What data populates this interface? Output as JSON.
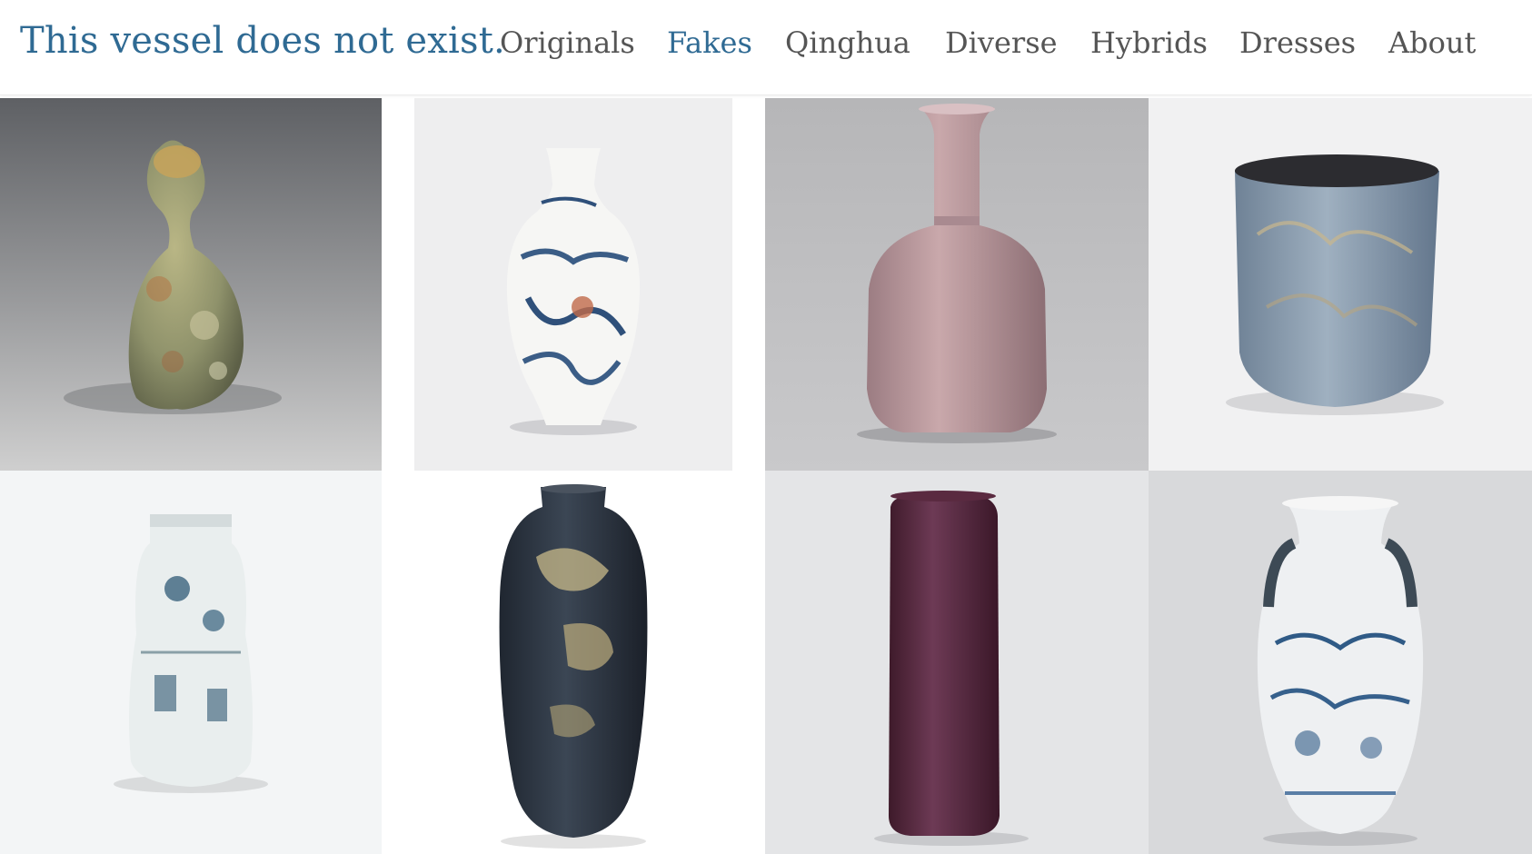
{
  "site": {
    "title": "This vessel does not exist."
  },
  "nav": {
    "items": [
      {
        "label": "Originals",
        "active": false
      },
      {
        "label": "Fakes",
        "active": true
      },
      {
        "label": "Qinghua",
        "active": false
      },
      {
        "label": "Diverse",
        "active": false
      },
      {
        "label": "Hybrids",
        "active": false
      },
      {
        "label": "Dresses",
        "active": false
      },
      {
        "label": "About",
        "active": false
      }
    ]
  },
  "colors": {
    "accent": "#2f6a93",
    "nav_text": "#555555"
  },
  "gallery": {
    "images": [
      {
        "name": "gourd-vase-celadon-image"
      },
      {
        "name": "blue-white-baluster-vase-image"
      },
      {
        "name": "pink-bottle-vase-image"
      },
      {
        "name": "blue-glazed-cup-image"
      },
      {
        "name": "white-blue-jar-image"
      },
      {
        "name": "dark-lacquer-vase-image"
      },
      {
        "name": "purple-cylinder-vase-image"
      },
      {
        "name": "blue-white-handled-vase-image"
      }
    ]
  }
}
